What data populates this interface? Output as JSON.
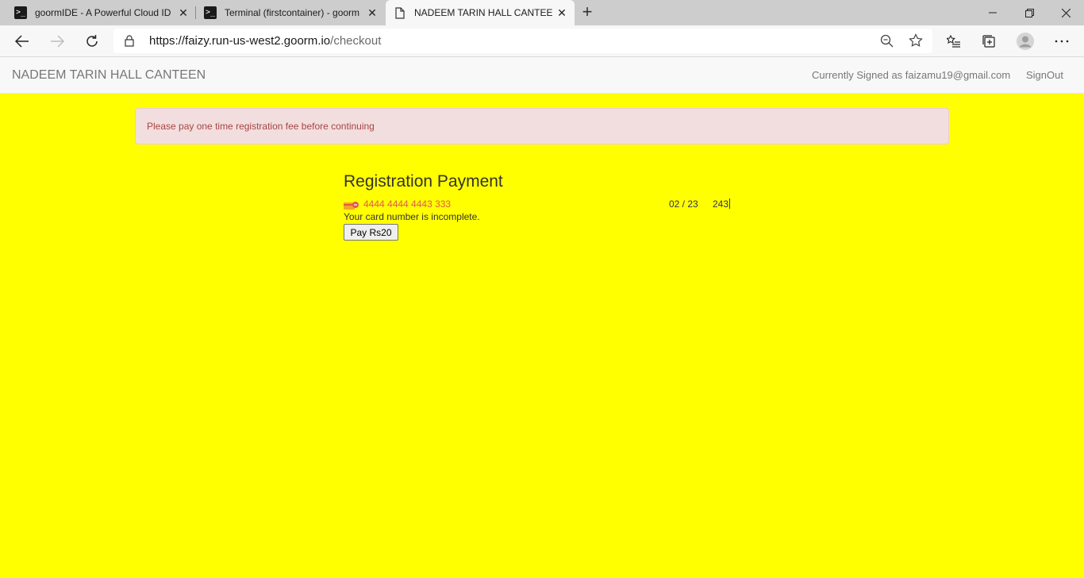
{
  "browser": {
    "tabs": [
      {
        "title": "goormIDE - A Powerful Cloud IDE",
        "icon": "terminal-icon"
      },
      {
        "title": "Terminal (firstcontainer) - goorm",
        "icon": "terminal-icon"
      },
      {
        "title": "NADEEM TARIN HALL CANTEEN",
        "icon": "page-icon"
      }
    ],
    "url_host": "https://faizy.run-us-west2.goorm.io",
    "url_path": "/checkout"
  },
  "navbar": {
    "brand": "NADEEM TARIN HALL CANTEEN",
    "signed_in_text": "Currently Signed as faizamu19@gmail.com",
    "signout_label": "SignOut"
  },
  "alert": {
    "message": "Please pay one time registration fee before continuing"
  },
  "payment": {
    "heading": "Registration Payment",
    "card_number": "4444 4444 4443 333",
    "expiry": "02 / 23",
    "cvc": "243",
    "error": "Your card number is incomplete.",
    "pay_label": "Pay Rs20"
  },
  "colors": {
    "page_background": "#ffff00",
    "alert_background": "#f2dede",
    "alert_text": "#a94442",
    "error_text": "#e25950"
  }
}
